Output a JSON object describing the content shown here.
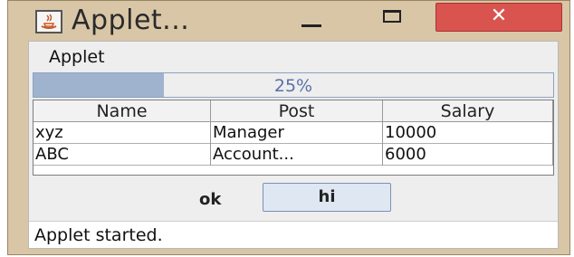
{
  "window": {
    "title": "Applet...",
    "close_glyph": "✕"
  },
  "menubar": {
    "menu_label": "Applet"
  },
  "progress": {
    "value": 0.25,
    "label": "25%",
    "fill_color": "#9fb3cf",
    "text_color": "#5872a8"
  },
  "table": {
    "headers": [
      "Name",
      "Post",
      "Salary"
    ],
    "rows": [
      [
        "xyz",
        "Manager",
        "10000"
      ],
      [
        "ABC",
        "Account...",
        "6000"
      ]
    ]
  },
  "buttons": {
    "ok_label": "ok",
    "hi_label": "hi"
  },
  "status": {
    "text": "Applet started."
  },
  "icons": {
    "app": "java-icon",
    "minimize": "minimize-icon",
    "maximize": "maximize-icon",
    "close": "close-icon"
  },
  "colors": {
    "frame": "#d9c6a7",
    "close_button": "#d9534f"
  }
}
